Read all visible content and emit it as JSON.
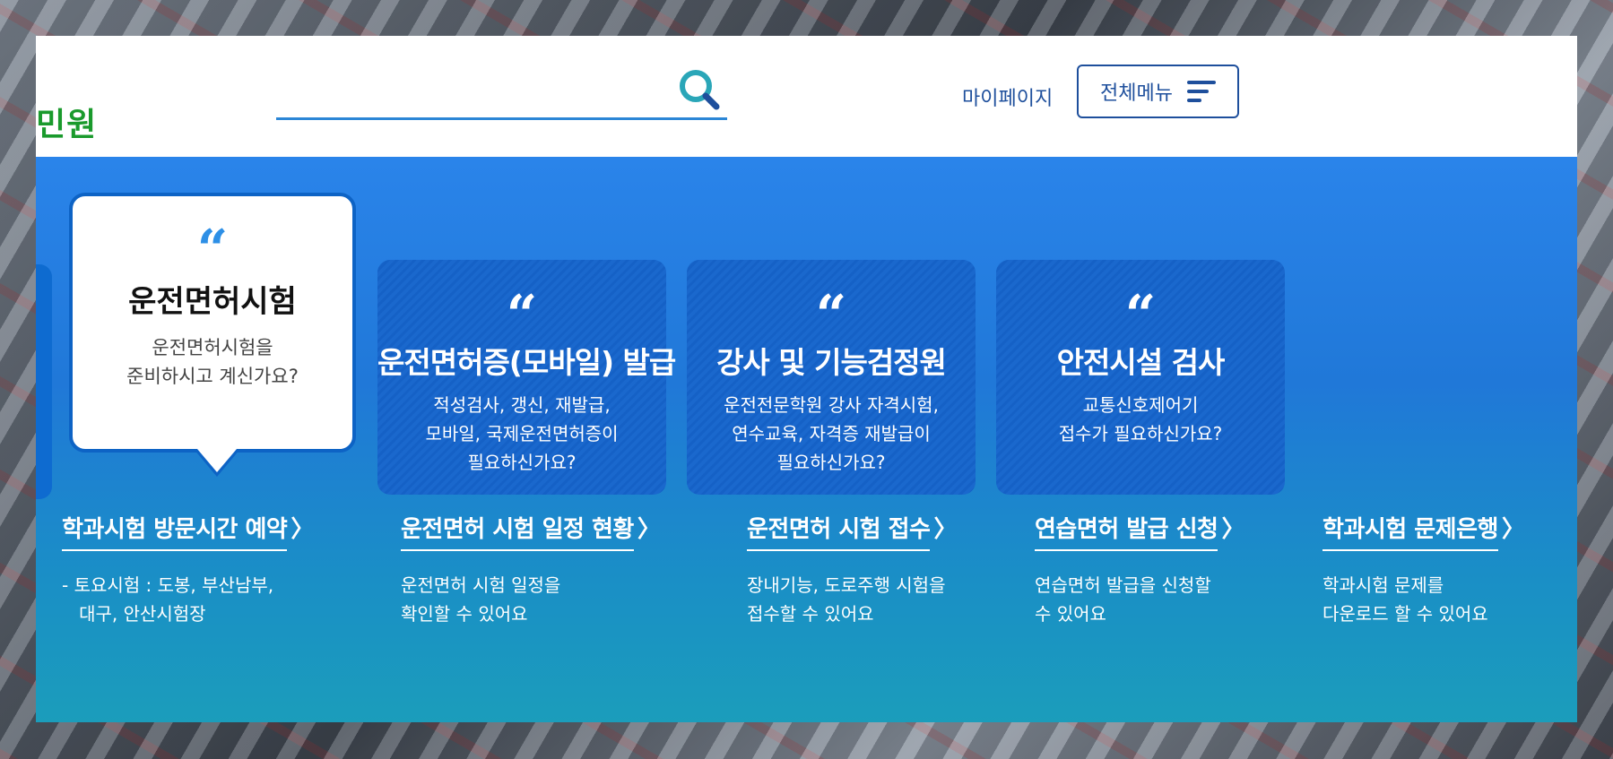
{
  "header": {
    "logo_text": "민원",
    "search_placeholder": "",
    "mypage_label": "마이페이지",
    "menu_label": "전체메뉴"
  },
  "cards": {
    "active": {
      "title": "운전면허시험",
      "desc_line1": "운전면허시험을",
      "desc_line2": "준비하시고 계신가요?"
    },
    "items": [
      {
        "title": "운전면허증(모바일) 발급",
        "desc_line1": "적성검사, 갱신, 재발급,",
        "desc_line2": "모바일, 국제운전면허증이",
        "desc_line3": "필요하신가요?"
      },
      {
        "title": "강사 및 기능검정원",
        "desc_line1": "운전전문학원 강사 자격시험,",
        "desc_line2": "연수교육, 자격증 재발급이",
        "desc_line3": "필요하신가요?"
      },
      {
        "title": "안전시설 검사",
        "desc_line1": "교통신호제어기",
        "desc_line2": "접수가 필요하신가요?",
        "desc_line3": ""
      }
    ],
    "quote_mark": "“"
  },
  "links": [
    {
      "title": "학과시험 방문시간 예약",
      "desc_line1": "- 토요시험 : 도봉, 부산남부,",
      "desc_line2": "   대구, 안산시험장"
    },
    {
      "title": "운전면허 시험 일정 현황",
      "desc_line1": "운전면허 시험 일정을",
      "desc_line2": "확인할 수 있어요"
    },
    {
      "title": "운전면허 시험 접수",
      "desc_line1": "장내기능, 도로주행 시험을",
      "desc_line2": "접수할 수 있어요"
    },
    {
      "title": "연습면허 발급 신청",
      "desc_line1": "연습면허 발급을 신청할",
      "desc_line2": "수 있어요"
    },
    {
      "title": "학과시험 문제은행",
      "desc_line1": "학과시험 문제를",
      "desc_line2": "다운로드 할 수 있어요"
    }
  ],
  "chevron": "〉",
  "colors": {
    "brand_green": "#1a9a2c",
    "primary_blue": "#1e4f9c",
    "panel_blue": "#2a84ea",
    "card_blue": "#1561c6",
    "search_icon_teal": "#2aa6b8"
  }
}
